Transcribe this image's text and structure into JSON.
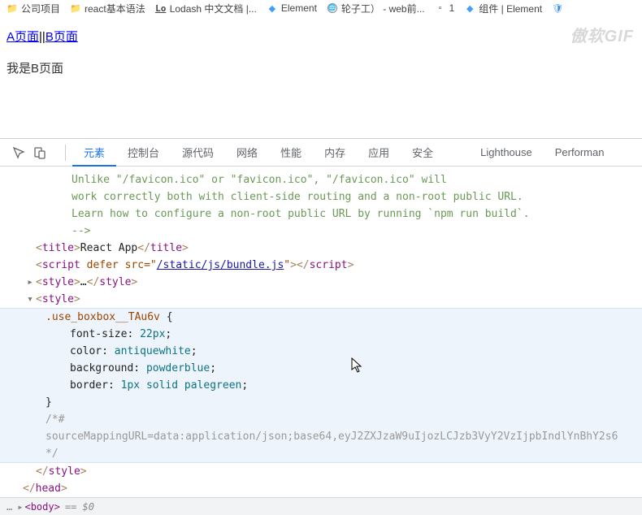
{
  "bookmarks": {
    "b1": "公司项目",
    "b2": "react基本语法",
    "b3": "Lodash 中文文档 |...",
    "b4": "Element",
    "b5": "轮子工） - web前...",
    "b6": "1",
    "b7": "组件 | Element"
  },
  "watermark": "傲软GIF",
  "page": {
    "linkA": "A页面",
    "sep": "||",
    "linkB": "B页面",
    "body": "我是B页面"
  },
  "devtools": {
    "tabs": {
      "elements": "元素",
      "console": "控制台",
      "sources": "源代码",
      "network": "网络",
      "performance": "性能",
      "memory": "内存",
      "application": "应用",
      "security": "安全",
      "lighthouse": "Lighthouse",
      "perf2": "Performan"
    },
    "comment": {
      "l1": "Unlike \"/favicon.ico\" or \"favicon.ico\", \"/favicon.ico\" will",
      "l2": "work correctly both with client-side routing and a non-root public URL.",
      "l3": "Learn how to configure a non-root public URL by running `npm run build`.",
      "l4": "-->"
    },
    "title": {
      "open": "<",
      "name": "title",
      "gt": ">",
      "txt": "React App",
      "close": "</",
      "end": ">"
    },
    "script": {
      "open": "<",
      "name": "script",
      "defer": " defer",
      "srcAttr": " src=\"",
      "srcVal": "/static/js/bundle.js",
      "srcEnd": "\"",
      "gt": ">",
      "close": "</",
      "end": ">"
    },
    "styleCollapsed": {
      "open": "<",
      "name": "style",
      "gt": ">",
      "dots": "…",
      "close": "</",
      "end": ">"
    },
    "styleOpen": {
      "open": "<",
      "name": "style",
      "gt": ">"
    },
    "css": {
      "sel": ".use_boxbox__TAu6v ",
      "ob": "{",
      "p1k": "font-size",
      "p1v": "22px",
      "p2k": "color",
      "p2v": "antiquewhite",
      "p3k": "background",
      "p3v": "powderblue",
      "p4k": "border",
      "p4v1": "1px",
      "p4v2": "solid",
      "p4v3": "palegreen",
      "cb": "}",
      "c1": "/*#",
      "c2": "sourceMappingURL=data:application/json;base64,eyJ2ZXJzaW9uIjozLCJzb3VyY2VzIjpbIndlYnBhY2s6",
      "c3": "*/"
    },
    "styleClose": {
      "open": "</",
      "name": "style",
      "end": ">"
    },
    "headClose": {
      "open": "</",
      "name": "head",
      "end": ">"
    },
    "bodyTag": {
      "open": "<",
      "name": "body",
      "gt": ">",
      "sel": " == $0"
    },
    "breadcrumb": {
      "dots": "…",
      "arrow": "▸"
    }
  }
}
